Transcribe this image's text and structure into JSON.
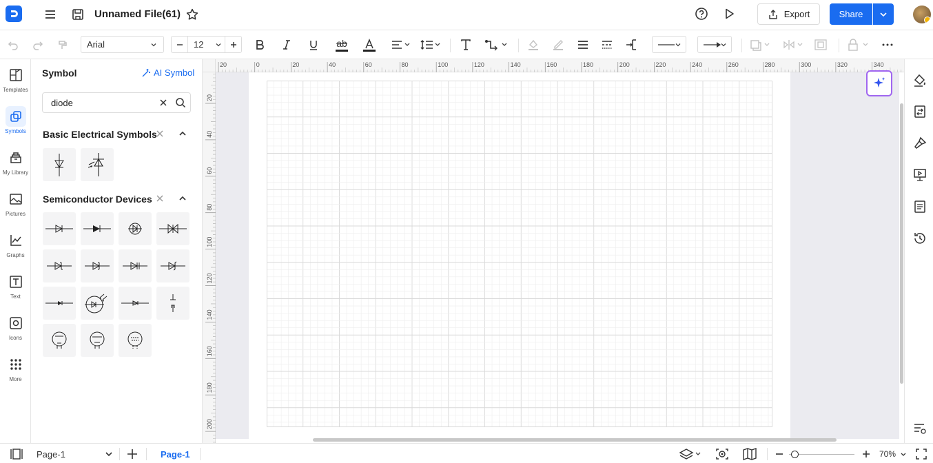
{
  "app": {
    "file_name": "Unnamed File(61)"
  },
  "header": {
    "export_label": "Export",
    "share_label": "Share"
  },
  "toolbar": {
    "font_family": "Arial",
    "font_size": "12",
    "underline_text_glyph": "ab"
  },
  "sidebar_nav": {
    "templates": "Templates",
    "symbols": "Symbols",
    "library": "My Library",
    "pictures": "Pictures",
    "graphs": "Graphs",
    "text": "Text",
    "icons": "Icons",
    "more": "More"
  },
  "symbol_panel": {
    "title": "Symbol",
    "ai_symbol_label": "AI Symbol",
    "search_value": "diode",
    "section1_title": "Basic Electrical Symbols",
    "section2_title": "Semiconductor Devices"
  },
  "ruler": {
    "top_ticks": [
      "20",
      "0",
      "20",
      "40",
      "60",
      "80",
      "100",
      "120",
      "140",
      "160",
      "180",
      "200",
      "220",
      "240",
      "260",
      "280",
      "300",
      "320",
      "340"
    ],
    "left_ticks": [
      "20",
      "40",
      "60",
      "80",
      "100",
      "120",
      "140",
      "160",
      "180",
      "200"
    ]
  },
  "footer": {
    "page_selector": "Page-1",
    "active_page_tab": "Page-1",
    "zoom": "70%",
    "zoom_level": 0.7
  },
  "colors": {
    "accent": "#1a6cf0",
    "ai_border": "#a066f0",
    "grid_minor": "#eeeeee",
    "grid_major": "#d9d9d9",
    "canvas_bg": "#ebebf0"
  }
}
